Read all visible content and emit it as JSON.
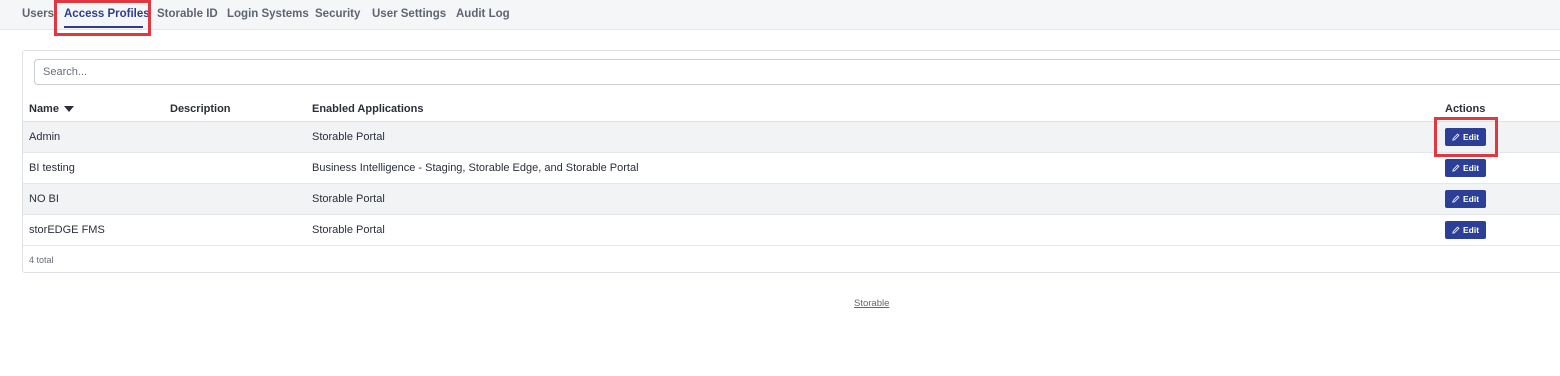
{
  "tabs": [
    {
      "label": "Users",
      "active": false
    },
    {
      "label": "Access Profiles",
      "active": true
    },
    {
      "label": "Storable ID",
      "active": false
    },
    {
      "label": "Login Systems",
      "active": false
    },
    {
      "label": "Security",
      "active": false
    },
    {
      "label": "User Settings",
      "active": false
    },
    {
      "label": "Audit Log",
      "active": false
    }
  ],
  "search": {
    "placeholder": "Search..."
  },
  "table": {
    "columns": {
      "name": "Name",
      "description": "Description",
      "enabled_applications": "Enabled Applications",
      "actions": "Actions"
    },
    "rows": [
      {
        "name": "Admin",
        "description": "",
        "enabled_applications": "Storable Portal",
        "action": "Edit"
      },
      {
        "name": "BI testing",
        "description": "",
        "enabled_applications": "Business Intelligence - Staging, Storable Edge, and Storable Portal",
        "action": "Edit"
      },
      {
        "name": "NO BI",
        "description": "",
        "enabled_applications": "Storable Portal",
        "action": "Edit"
      },
      {
        "name": "storEDGE FMS",
        "description": "",
        "enabled_applications": "Storable Portal",
        "action": "Edit"
      }
    ],
    "total": "4 total"
  },
  "footer": {
    "link": "Storable"
  },
  "icons": {
    "sort": "sort-down-icon",
    "edit": "pencil-icon"
  },
  "colors": {
    "accent": "#2c3e8f",
    "button": "#2b3f96",
    "highlight": "#e0383e"
  }
}
